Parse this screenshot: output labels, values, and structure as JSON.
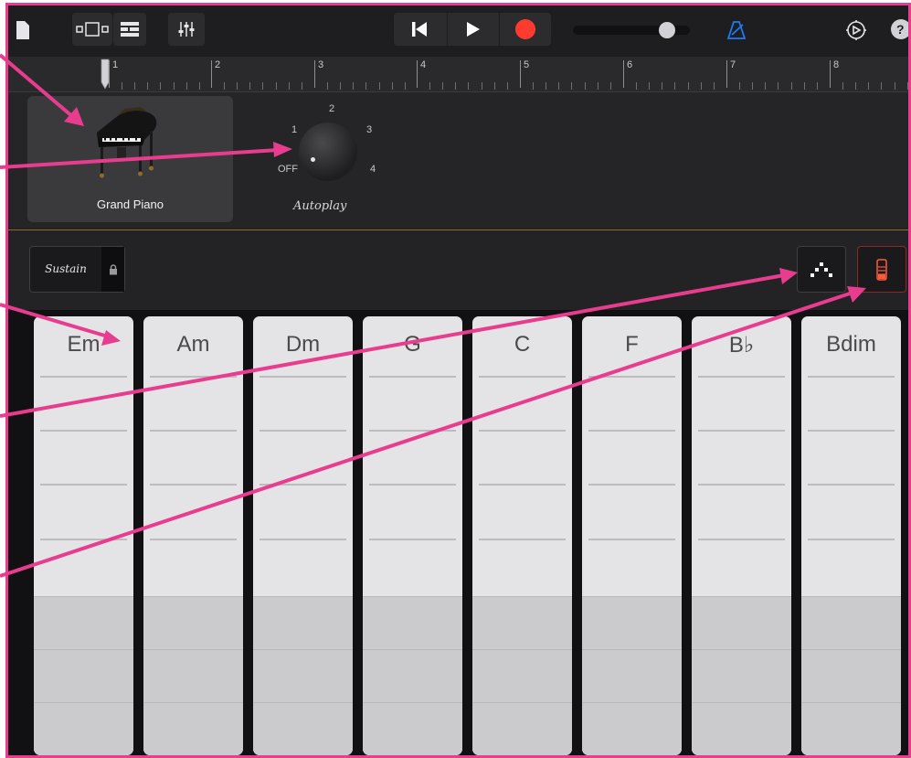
{
  "toolbar": {
    "icons": [
      "document-icon",
      "view-toggle-icon",
      "tracks-list-icon",
      "mixer-icon",
      "rewind-icon",
      "play-icon",
      "record-icon",
      "volume-slider",
      "metronome-icon",
      "settings-icon",
      "help-icon"
    ],
    "record_color": "#ff3b30",
    "metronome_color": "#1a7cf6",
    "help_label": "?"
  },
  "ruler": {
    "bars": [
      "1",
      "2",
      "3",
      "4",
      "5",
      "6",
      "7",
      "8"
    ]
  },
  "instrument": {
    "name": "Grand Piano"
  },
  "autoplay": {
    "label": "Autoplay",
    "positions": [
      "OFF",
      "1",
      "2",
      "3",
      "4"
    ],
    "current": "OFF"
  },
  "sustain": {
    "label": "Sustain"
  },
  "chords": [
    "Em",
    "Am",
    "Dm",
    "G",
    "C",
    "F",
    "B♭",
    "Bdim"
  ],
  "colors": {
    "annotation_arrow": "#e83d8e",
    "accent_gold": "#b48c3a",
    "chord_strip": "#e4e4e6"
  }
}
